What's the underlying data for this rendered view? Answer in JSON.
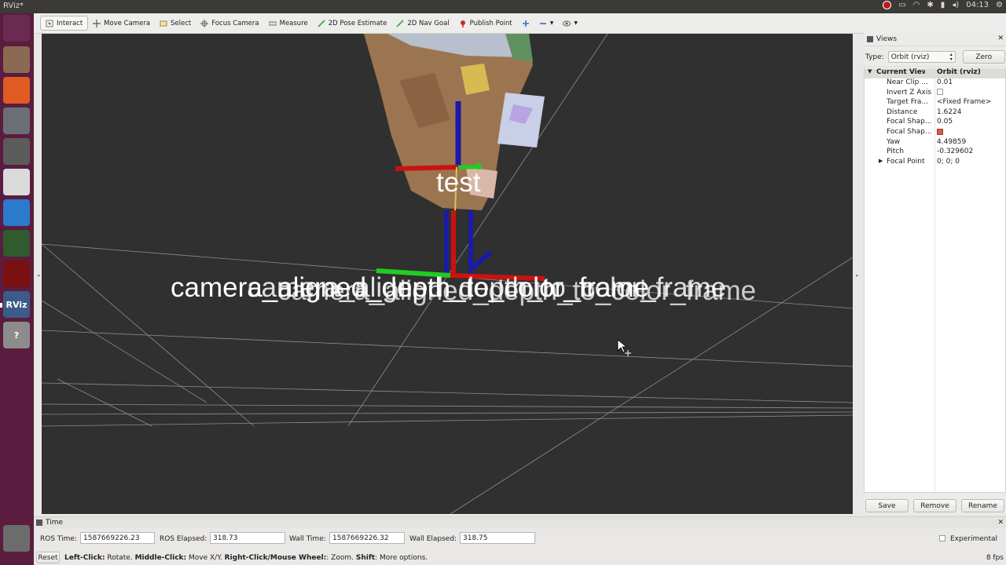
{
  "topbar": {
    "title": "RViz*",
    "clock": "04:13"
  },
  "launcher": {
    "items": [
      {
        "icon": "ubuntu-dash-icon",
        "bg": "#6b2a4f"
      },
      {
        "icon": "files-icon",
        "bg": "#8a6a53"
      },
      {
        "icon": "software-center-icon",
        "bg": "#e05a23"
      },
      {
        "icon": "system-settings-icon",
        "bg": "#6a6f75"
      },
      {
        "icon": "screenshot-icon",
        "bg": "#5b5b5b"
      },
      {
        "icon": "chrome-icon",
        "bg": "#dadada"
      },
      {
        "icon": "vscode-icon",
        "bg": "#2c7acc"
      },
      {
        "icon": "globe-icon",
        "bg": "#2f5b2f"
      },
      {
        "icon": "terminal-icon",
        "bg": "#7a1010"
      },
      {
        "icon": "rviz-icon",
        "bg": "#3b5c8a",
        "label": "RViz"
      },
      {
        "icon": "help-icon",
        "bg": "#8c8c8c",
        "label": "?"
      },
      {
        "icon": "trash-icon",
        "bg": "#6c6c6c"
      }
    ]
  },
  "toolbar": {
    "tools": [
      {
        "name": "interact",
        "label": "Interact",
        "active": true
      },
      {
        "name": "move-camera",
        "label": "Move Camera"
      },
      {
        "name": "select",
        "label": "Select"
      },
      {
        "name": "focus-camera",
        "label": "Focus Camera"
      },
      {
        "name": "measure",
        "label": "Measure"
      },
      {
        "name": "2d-pose-estimate",
        "label": "2D Pose Estimate"
      },
      {
        "name": "2d-nav-goal",
        "label": "2D Nav Goal"
      },
      {
        "name": "publish-point",
        "label": "Publish Point"
      }
    ]
  },
  "viewport": {
    "label_test": "test",
    "label_frames": "camera_aligned_depth_to_color_frame"
  },
  "views_panel": {
    "title": "Views",
    "type_label": "Type:",
    "type_value": "Orbit (rviz)",
    "zero_button": "Zero",
    "header_key": "Current View",
    "header_value": "Orbit (rviz)",
    "rows": [
      {
        "key": "Near Clip ...",
        "value": "0.01"
      },
      {
        "key": "Invert Z Axis",
        "value": "",
        "checkbox": false
      },
      {
        "key": "Target Fra...",
        "value": "<Fixed Frame>"
      },
      {
        "key": "Distance",
        "value": "1.6224"
      },
      {
        "key": "Focal Shap...",
        "value": "0.05"
      },
      {
        "key": "Focal Shap...",
        "value": "",
        "checkbox": true
      },
      {
        "key": "Yaw",
        "value": "4.49859"
      },
      {
        "key": "Pitch",
        "value": "-0.329602"
      },
      {
        "key": "Focal Point",
        "value": "0; 0; 0",
        "expandable": true
      }
    ],
    "save_button": "Save",
    "remove_button": "Remove",
    "rename_button": "Rename"
  },
  "time_panel": {
    "title": "Time",
    "ros_time_label": "ROS Time:",
    "ros_time": "1587669226.23",
    "ros_elapsed_label": "ROS Elapsed:",
    "ros_elapsed": "318.73",
    "wall_time_label": "Wall Time:",
    "wall_time": "1587669226.32",
    "wall_elapsed_label": "Wall Elapsed:",
    "wall_elapsed": "318.75",
    "experimental_label": "Experimental"
  },
  "status": {
    "reset_button": "Reset",
    "left_click": "Left-Click:",
    "left_click_desc": "Rotate.",
    "middle_click": "Middle-Click:",
    "middle_click_desc": "Move X/Y.",
    "right_click": "Right-Click/Mouse Wheel:",
    "right_click_desc": ": Zoom.",
    "shift": "Shift",
    "shift_desc": ": More options.",
    "fps": "8 fps"
  }
}
